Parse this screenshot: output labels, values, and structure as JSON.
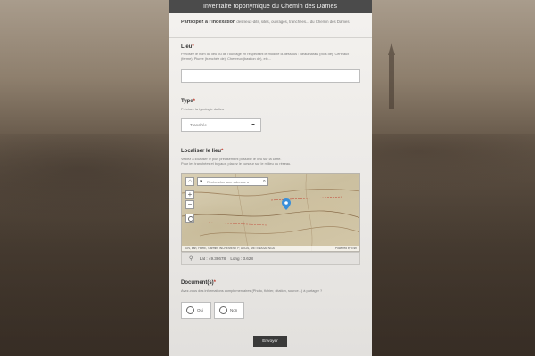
{
  "header": {
    "title": "Inventaire toponymique du Chemin des Dames"
  },
  "intro": {
    "lead": "Participez à l'indexation",
    "rest": " des lieux-dits, sites, ouvrages, tranchées... du Chemin des Dames."
  },
  "lieu": {
    "label": "Lieu",
    "required_mark": "*",
    "help": "Précisez le nom du lieu ou de l'ouvrage en respectant le modèle ci-dessous : Beaumarais (bois de), Certeaux (ferme), Piume (tranchée de), Chevreux (bastion de), etc...",
    "value": ""
  },
  "type": {
    "label": "Type",
    "required_mark": "*",
    "help": "Précisez la typologie du lieu",
    "selected": "Tranchée"
  },
  "localiser": {
    "label": "Localiser le lieu",
    "required_mark": "*",
    "help_line1": "Veillez à localiser le plus précisément possible le lieu sur la carte.",
    "help_line2": "Pour les tranchées et boyaux, placez le curseur sur le milieu du réseau."
  },
  "map": {
    "home_symbol": "⌂",
    "dropdown_symbol": "▾",
    "search_placeholder": "Rechercher une adresse o",
    "search_symbol": "⌕",
    "zoom_in": "+",
    "zoom_out": "−",
    "attribution": "IGN, Esri, HERE, Garmin, INCREMENT P, USGS, METI/NASA, NGA",
    "powered_by": "Powered by Esri",
    "pin_color": "#3a8fd9"
  },
  "coords": {
    "lat_label": "Lat :",
    "lat": "49.38678",
    "long_label": "Long :",
    "long": "3.628"
  },
  "documents": {
    "label": "Document(s)",
    "required_mark": "*",
    "help": "Avez-vous des informations complémentaires (Photo, fichier, citation, source...) à partager ?",
    "options": [
      "Oui",
      "Non"
    ]
  },
  "submit_label": "Envoyer"
}
